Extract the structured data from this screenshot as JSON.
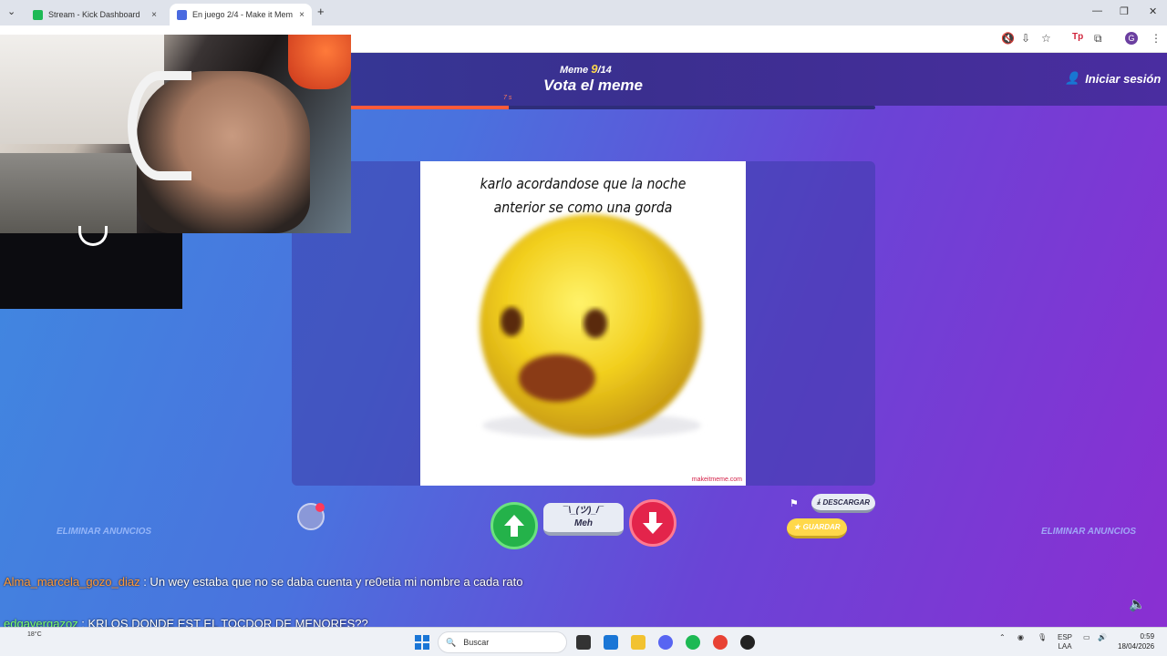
{
  "browser": {
    "tabs": [
      {
        "title": "Stream - Kick Dashboard",
        "close": "×"
      },
      {
        "title": "En juego 2/4 - Make it Mem",
        "close": "×"
      }
    ],
    "new_tab": "+",
    "tab_menu": "⌄",
    "window": {
      "minimize": "—",
      "restore": "❐",
      "close": "✕"
    },
    "profile_initial": "G"
  },
  "game": {
    "meme_label": "Meme",
    "meme_current": "9",
    "meme_total": "/14",
    "title": "Vota el meme",
    "login": "Iniciar sesión",
    "timer_label": "7 s",
    "timer_progress": 0.3,
    "meme_caption": "karlo acordandose que la noche anterior se como una gorda",
    "watermark": "makeitmeme.com",
    "meh_face": "¯\\_(ツ)_/¯",
    "meh_label": "Meh",
    "download_label": "DESCARGAR",
    "save_label": "GUARDAR",
    "remove_ads_left": "ELIMINAR ANUNCIOS",
    "remove_ads_right": "ELIMINAR ANUNCIOS"
  },
  "chat": [
    {
      "user": "Alma_marcela_gozo_diaz",
      "message": " : Un wey estaba que no se daba cuenta y re0etia mi nombre a cada rato"
    },
    {
      "user": "edgavergazoz",
      "message": " : KRLOS DONDE EST EL TOCDOR DE MENORES??"
    }
  ],
  "taskbar": {
    "weather": "18°C",
    "search_placeholder": "Buscar",
    "lang_top": "ESP",
    "lang_bottom": "LAA",
    "time": "0:59",
    "date": "18/04/2026"
  },
  "colors": {
    "upvote": "#24b24a",
    "downvote": "#e3244b",
    "accent": "#ffd84a"
  }
}
